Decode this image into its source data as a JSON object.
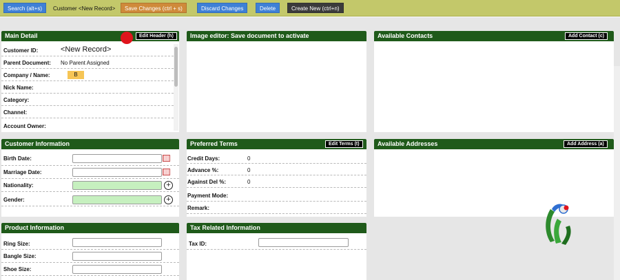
{
  "toolbar": {
    "search": "Search (alt+s)",
    "record_label": "Customer <New Record>",
    "save": "Save Changes (ctrl + s)",
    "discard": "Discard Changes",
    "delete": "Delete",
    "create": "Create New (ctrl+n)"
  },
  "main_detail": {
    "title": "Main Detail",
    "edit_header": "Edit Header (h)",
    "rows": [
      {
        "label": "Customer ID:",
        "value": "<New Record>"
      },
      {
        "label": "Parent Document:",
        "value": "No Parent Assigned"
      },
      {
        "label": "Company / Name:",
        "value": "B"
      },
      {
        "label": "Nick Name:",
        "value": ""
      },
      {
        "label": "Category:",
        "value": ""
      },
      {
        "label": "Channel:",
        "value": ""
      },
      {
        "label": "Account Owner:",
        "value": ""
      }
    ]
  },
  "image_editor": {
    "title": "Image editor: Save document to activate"
  },
  "contacts": {
    "title": "Available Contacts",
    "add": "Add Contact (c)"
  },
  "customer_info": {
    "title": "Customer Information",
    "rows": [
      {
        "label": "Birth Date:"
      },
      {
        "label": "Marriage Date:"
      },
      {
        "label": "Nationality:"
      },
      {
        "label": "Gender:"
      }
    ]
  },
  "terms": {
    "title": "Preferred Terms",
    "edit": "Edit Terms (t)",
    "rows": [
      {
        "label": "Credit Days:",
        "value": "0"
      },
      {
        "label": "Advance %:",
        "value": "0"
      },
      {
        "label": "Against Del %:",
        "value": "0"
      },
      {
        "label": "Payment Mode:",
        "value": ""
      },
      {
        "label": "Remark:",
        "value": ""
      }
    ]
  },
  "addresses": {
    "title": "Available Addresses",
    "add": "Add Address (a)"
  },
  "product_info": {
    "title": "Product Information",
    "rows": [
      {
        "label": "Ring Size:"
      },
      {
        "label": "Bangle Size:"
      },
      {
        "label": "Shoe Size:"
      }
    ]
  },
  "tax_info": {
    "title": "Tax Related Information",
    "rows": [
      {
        "label": "Tax ID:"
      }
    ]
  },
  "icons": {
    "calendar": "calendar-icon",
    "add_circle": "plus-circle-icon",
    "logo": "brand-logo"
  },
  "colors": {
    "toolbar": "#c3c86a",
    "panel_header": "#1f5a1a",
    "primary_button": "#3f80d6",
    "save_button": "#cf8a3a",
    "green_field": "#c6f0bf"
  }
}
